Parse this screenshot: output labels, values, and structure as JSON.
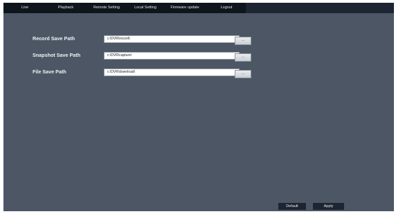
{
  "menu": {
    "items": [
      {
        "label": "Live"
      },
      {
        "label": "Playback"
      },
      {
        "label": "Remote Setting"
      },
      {
        "label": "Local Setting"
      },
      {
        "label": "Firmware update"
      },
      {
        "label": "Logout"
      }
    ]
  },
  "settings": {
    "record": {
      "label": "Record Save Path",
      "value": "c:\\DVR\\record\\"
    },
    "snapshot": {
      "label": "Snapshot Save Path",
      "value": "c:\\DVR\\capture\\"
    },
    "file": {
      "label": "File Save Path",
      "value": "c:\\DVR\\download\\"
    },
    "browse_label": "..."
  },
  "footer": {
    "default_label": "Default",
    "apply_label": "Apply"
  },
  "colors": {
    "background": "#4c5665",
    "menu_bar": "#0f151d",
    "top_bar": "#1c2531"
  }
}
